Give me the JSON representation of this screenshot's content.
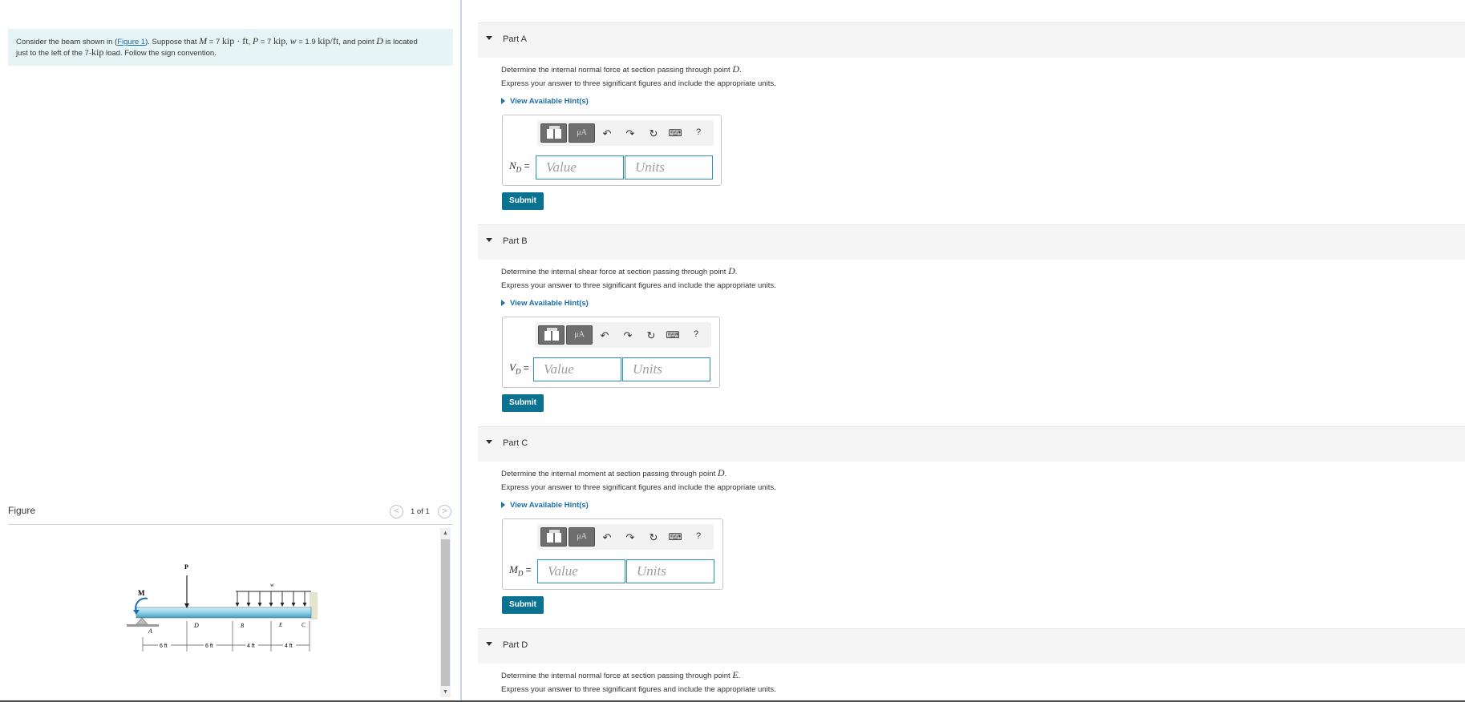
{
  "intro": {
    "text_1": "Consider the beam shown in (",
    "figure_link": "Figure 1",
    "text_2": "). Suppose that ",
    "m_var": "M",
    "m_value": " = 7 ",
    "m_unit": "kip · ft",
    "p_var": "P",
    "p_value": " = 7 ",
    "p_unit": "kip",
    "w_var": "w",
    "w_value": " = 1.9 ",
    "w_unit": "kip/ft",
    "text_3": ", and point ",
    "d_var": "D",
    "text_4": " is located",
    "line2_a": "just to the left of the 7-",
    "line2_kip": "kip",
    "line2_b": " load. Follow the sign convention."
  },
  "figure_panel": {
    "title": "Figure",
    "prev_icon": "<",
    "next_icon": ">",
    "pager": "1 of 1"
  },
  "figure": {
    "label_M": "M",
    "label_P": "P",
    "label_w": "w",
    "label_A": "A",
    "label_D": "D",
    "label_B": "B",
    "label_E": "E",
    "label_C": "C",
    "dim_1": "6 ft",
    "dim_2": "6 ft",
    "dim_3": "4 ft",
    "dim_4": "4 ft"
  },
  "parts": [
    {
      "label": "Part A",
      "question_text": "Determine the internal normal force at section passing through point ",
      "question_var": "D",
      "question_end": ".",
      "instruction": "Express your answer to three significant figures and include the appropriate units.",
      "hint": "View Available Hint(s)",
      "answer_var": "N",
      "answer_sub": "D",
      "answer_eq": " =",
      "value_placeholder": "Value",
      "units_placeholder": "Units",
      "submit": "Submit"
    },
    {
      "label": "Part B",
      "question_text": "Determine the internal shear force at section passing through point ",
      "question_var": "D",
      "question_end": ".",
      "instruction": "Express your answer to three significant figures and include the appropriate units.",
      "hint": "View Available Hint(s)",
      "answer_var": "V",
      "answer_sub": "D",
      "answer_eq": " =",
      "value_placeholder": "Value",
      "units_placeholder": "Units",
      "submit": "Submit"
    },
    {
      "label": "Part C",
      "question_text": "Determine the internal moment at section passing through point ",
      "question_var": "D",
      "question_end": ".",
      "instruction": "Express your answer to three significant figures and include the appropriate units.",
      "hint": "View Available Hint(s)",
      "answer_var": "M",
      "answer_sub": "D",
      "answer_eq": " =",
      "value_placeholder": "Value",
      "units_placeholder": "Units",
      "submit": "Submit"
    },
    {
      "label": "Part D",
      "question_text": "Determine the internal normal force at section passing through point ",
      "question_var": "E",
      "question_end": ".",
      "instruction": "Express your answer to three significant figures and include the appropriate units."
    }
  ],
  "toolbar": {
    "mu_label": "μA",
    "undo_icon": "↶",
    "redo_icon": "↷",
    "reset_icon": "↻",
    "keyboard_icon": "⌨",
    "help_label": "?"
  },
  "colors": {
    "accent": "#0b7391",
    "link": "#1a6fa8",
    "intro_bg": "#e6f4f6",
    "beam": "#8fd0e8"
  }
}
